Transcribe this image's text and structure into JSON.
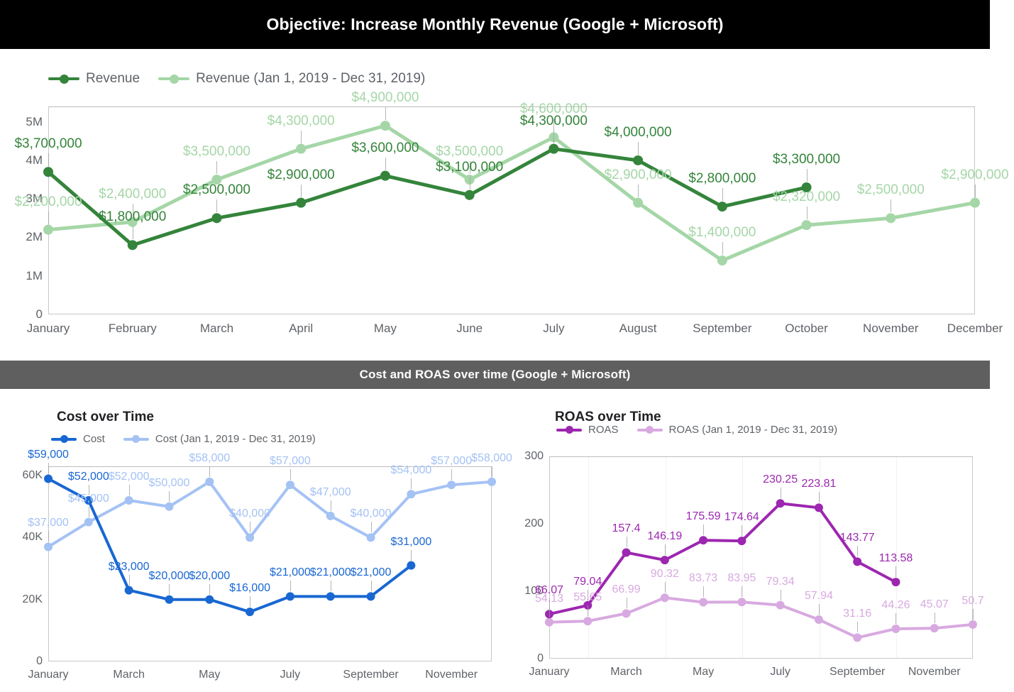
{
  "header": {
    "main_title": "Objective: Increase Monthly Revenue (Google + Microsoft)",
    "section_title": "Cost and ROAS over time (Google + Microsoft)"
  },
  "colors": {
    "revenue_current": "#34843B",
    "revenue_previous": "#A5D6A7",
    "cost_current": "#1967D2",
    "cost_previous": "#A4C2F4",
    "roas_current": "#9C27B0",
    "roas_previous": "#D8A9E0",
    "title_bg": "#000000",
    "section_bg": "#5F5F5F",
    "axis_text": "#5F6368"
  },
  "revenue_legend": [
    {
      "label": "Revenue",
      "color": "#34843B"
    },
    {
      "label": "Revenue (Jan 1, 2019 - Dec 31, 2019)",
      "color": "#A5D6A7"
    }
  ],
  "cost_legend": [
    {
      "label": "Cost",
      "color": "#1967D2"
    },
    {
      "label": "Cost (Jan 1, 2019 - Dec 31, 2019)",
      "color": "#A4C2F4"
    }
  ],
  "roas_legend": [
    {
      "label": "ROAS",
      "color": "#9C27B0"
    },
    {
      "label": "ROAS (Jan 1, 2019 - Dec 31, 2019)",
      "color": "#D8A9E0"
    }
  ],
  "panels": {
    "cost_title": "Cost over Time",
    "roas_title": "ROAS over Time"
  },
  "chart_data": [
    {
      "id": "revenue",
      "type": "line",
      "title": "Objective: Increase Monthly Revenue (Google + Microsoft)",
      "xlabel": "",
      "ylabel": "",
      "ylim": [
        0,
        5400000
      ],
      "yticks": [
        0,
        1000000,
        2000000,
        3000000,
        4000000,
        5000000
      ],
      "ytick_labels": [
        "0",
        "1M",
        "2M",
        "3M",
        "4M",
        "5M"
      ],
      "grid": false,
      "legend_position": "top-left",
      "categories": [
        "January",
        "February",
        "March",
        "April",
        "May",
        "June",
        "July",
        "August",
        "September",
        "October",
        "November",
        "December"
      ],
      "series": [
        {
          "name": "Revenue",
          "color": "#34843B",
          "values": [
            3700000,
            1800000,
            2500000,
            2900000,
            3600000,
            3100000,
            4300000,
            4000000,
            2800000,
            3300000,
            null,
            null
          ],
          "labels": [
            "$3,700,000",
            "$1,800,000",
            "$2,500,000",
            "$2,900,000",
            "$3,600,000",
            "$3,100,000",
            "$4,300,000",
            "$4,000,000",
            "$2,800,000",
            "$3,300,000",
            null,
            null
          ]
        },
        {
          "name": "Revenue (Jan 1, 2019 - Dec 31, 2019)",
          "color": "#A5D6A7",
          "values": [
            2200000,
            2400000,
            3500000,
            4300000,
            4900000,
            3500000,
            4600000,
            2900000,
            1400000,
            2320000,
            2500000,
            2900000
          ],
          "labels": [
            "$2,200,000",
            "$2,400,000",
            "$3,500,000",
            "$4,300,000",
            "$4,900,000",
            "$3,500,000",
            "$4,600,000",
            "$2,900,000",
            "$1,400,000",
            "$2,320,000",
            "$2,500,000",
            "$2,900,000"
          ]
        }
      ]
    },
    {
      "id": "cost",
      "type": "line",
      "title": "Cost over Time",
      "xlabel": "",
      "ylabel": "",
      "ylim": [
        0,
        63000
      ],
      "yticks": [
        0,
        20000,
        40000,
        60000
      ],
      "ytick_labels": [
        "0",
        "20K",
        "40K",
        "60K"
      ],
      "grid": false,
      "legend_position": "top-left",
      "categories": [
        "January",
        "February",
        "March",
        "April",
        "May",
        "June",
        "July",
        "August",
        "September",
        "October",
        "November",
        "December"
      ],
      "xtick_labels": [
        "January",
        "March",
        "May",
        "July",
        "September",
        "November"
      ],
      "series": [
        {
          "name": "Cost",
          "color": "#1967D2",
          "values": [
            59000,
            52000,
            23000,
            20000,
            20000,
            16000,
            21000,
            21000,
            21000,
            31000,
            null,
            null
          ],
          "labels": [
            "$59,000",
            "$52,000",
            "$23,000",
            "$20,000",
            "$20,000",
            "$16,000",
            "$21,000",
            "$21,000",
            "$21,000",
            "$31,000",
            null,
            null
          ]
        },
        {
          "name": "Cost (Jan 1, 2019 - Dec 31, 2019)",
          "color": "#A4C2F4",
          "values": [
            37000,
            45000,
            52000,
            50000,
            58000,
            40000,
            57000,
            47000,
            40000,
            54000,
            57000,
            58000
          ],
          "labels": [
            "$37,000",
            "$45,000",
            "$52,000",
            "$50,000",
            "$58,000",
            "$40,000",
            "$57,000",
            "$47,000",
            "$40,000",
            "$54,000",
            "$57,000",
            "$58,000"
          ]
        }
      ]
    },
    {
      "id": "roas",
      "type": "line",
      "title": "ROAS over Time",
      "xlabel": "",
      "ylabel": "",
      "ylim": [
        0,
        300
      ],
      "yticks": [
        0,
        100,
        200,
        300
      ],
      "ytick_labels": [
        "0",
        "100",
        "200",
        "300"
      ],
      "grid": true,
      "legend_position": "top-left",
      "categories": [
        "January",
        "February",
        "March",
        "April",
        "May",
        "June",
        "July",
        "August",
        "September",
        "October",
        "November",
        "December"
      ],
      "xtick_labels": [
        "January",
        "March",
        "May",
        "July",
        "September",
        "November"
      ],
      "series": [
        {
          "name": "ROAS",
          "color": "#9C27B0",
          "values": [
            66.07,
            79.04,
            157.4,
            146.19,
            175.59,
            174.64,
            230.25,
            223.81,
            143.77,
            113.58,
            null,
            null
          ],
          "labels": [
            "66.07",
            "79.04",
            "157.4",
            "146.19",
            "175.59",
            "174.64",
            "230.25",
            "223.81",
            "143.77",
            "113.58",
            null,
            null
          ]
        },
        {
          "name": "ROAS (Jan 1, 2019 - Dec 31, 2019)",
          "color": "#D8A9E0",
          "values": [
            54.13,
            55.65,
            66.99,
            90.32,
            83.73,
            83.95,
            79.34,
            57.94,
            31.16,
            44.26,
            45.07,
            50.7
          ],
          "labels": [
            "54.13",
            "55.65",
            "66.99",
            "90.32",
            "83.73",
            "83.95",
            "79.34",
            "57.94",
            "31.16",
            "44.26",
            "45.07",
            "50.7"
          ]
        }
      ]
    }
  ]
}
